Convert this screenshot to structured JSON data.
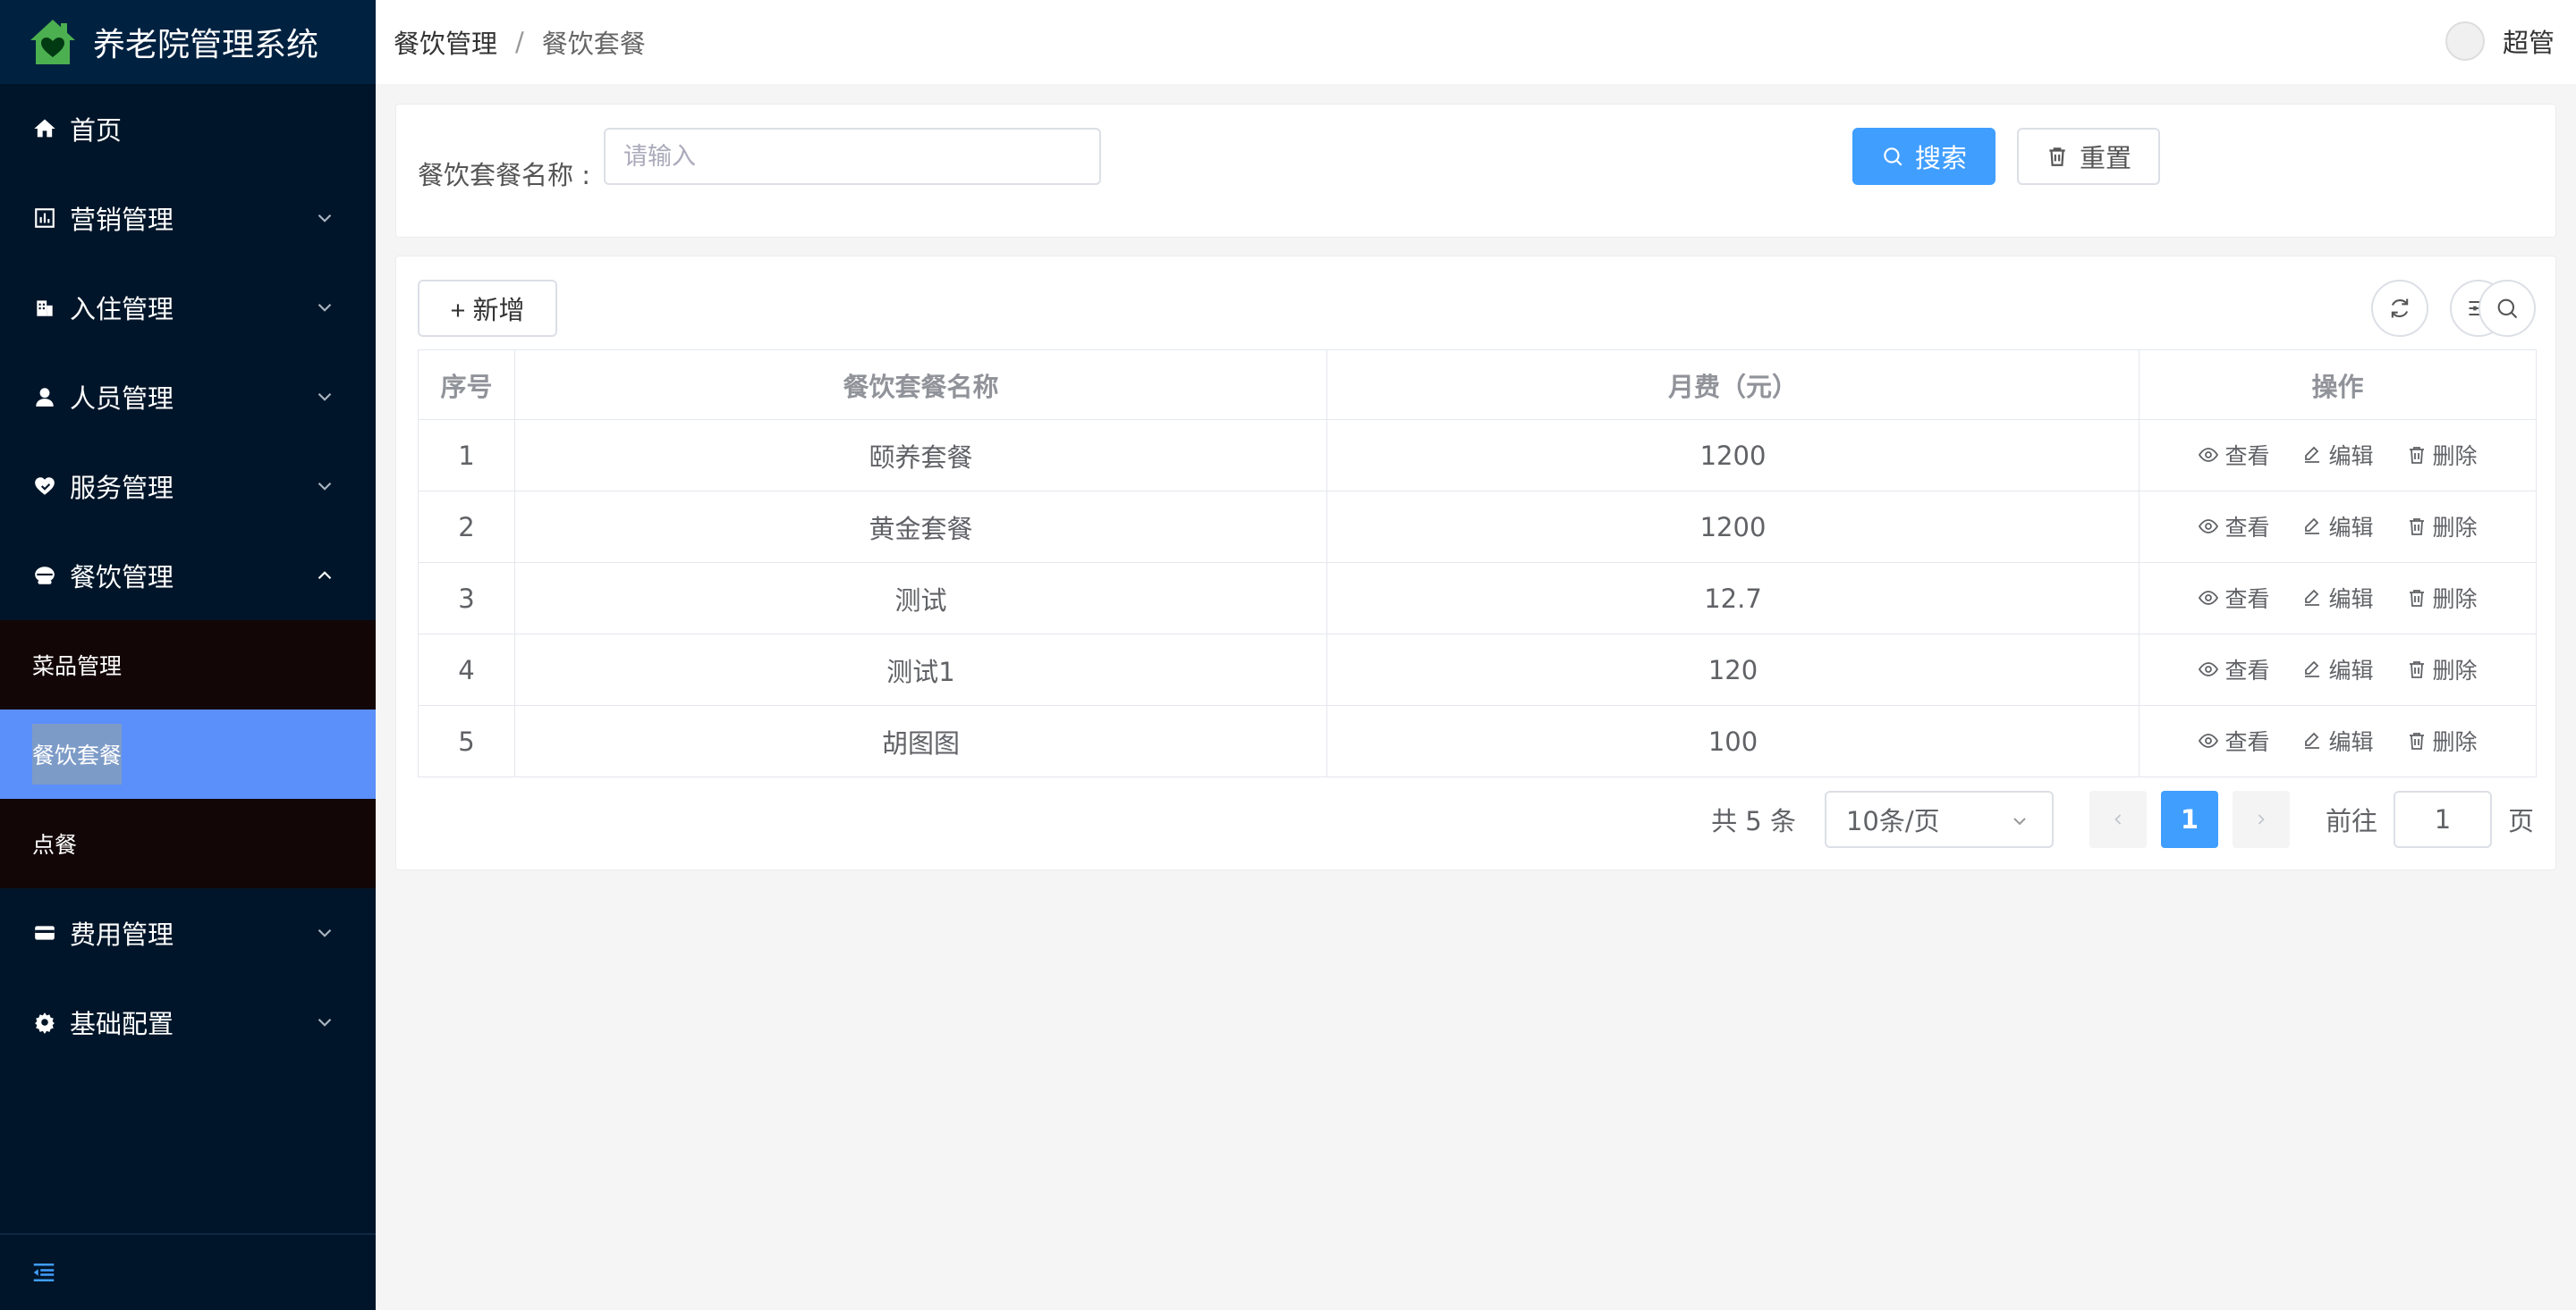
{
  "app": {
    "title": "养老院管理系统",
    "brand_color": "#4caf50"
  },
  "sidebar": {
    "items": [
      {
        "label": "首页",
        "icon": "home-icon",
        "expandable": false
      },
      {
        "label": "营销管理",
        "icon": "chart-icon",
        "expandable": true
      },
      {
        "label": "入住管理",
        "icon": "building-icon",
        "expandable": true
      },
      {
        "label": "人员管理",
        "icon": "user-icon",
        "expandable": true
      },
      {
        "label": "服务管理",
        "icon": "heart-hand-icon",
        "expandable": true
      },
      {
        "label": "餐饮管理",
        "icon": "bowl-icon",
        "expandable": true,
        "expanded": true
      },
      {
        "label": "费用管理",
        "icon": "card-icon",
        "expandable": true
      },
      {
        "label": "基础配置",
        "icon": "gear-icon",
        "expandable": true
      }
    ],
    "submenu": [
      {
        "label": "菜品管理",
        "active": false
      },
      {
        "label": "餐饮套餐",
        "active": true
      },
      {
        "label": "点餐",
        "active": false
      }
    ]
  },
  "header": {
    "breadcrumb": [
      "餐饮管理",
      "餐饮套餐"
    ],
    "separator": "/",
    "user_name": "超管"
  },
  "search": {
    "label": "餐饮套餐名称 :",
    "placeholder": "请输入",
    "search_button": "搜索",
    "reset_button": "重置"
  },
  "toolbar": {
    "add_button": "+ 新增",
    "tool_icons": [
      "refresh-icon",
      "settings-sliders-icon",
      "search-icon"
    ]
  },
  "table": {
    "columns": [
      "序号",
      "餐饮套餐名称",
      "月费（元）",
      "操作"
    ],
    "rows": [
      {
        "index": "1",
        "name": "颐养套餐",
        "fee": "1200"
      },
      {
        "index": "2",
        "name": "黄金套餐",
        "fee": "1200"
      },
      {
        "index": "3",
        "name": "测试",
        "fee": "12.7"
      },
      {
        "index": "4",
        "name": "测试1",
        "fee": "120"
      },
      {
        "index": "5",
        "name": "胡图图",
        "fee": "100"
      }
    ],
    "actions": {
      "view": "查看",
      "edit": "编辑",
      "delete": "删除"
    }
  },
  "pagination": {
    "total_text": "共 5 条",
    "page_size": "10条/页",
    "current_page": "1",
    "goto_label": "前往",
    "goto_value": "1",
    "page_unit": "页"
  },
  "colors": {
    "sidebar_bg": "#001529",
    "primary": "#409eff",
    "active_submenu": "#5b8ff9"
  }
}
